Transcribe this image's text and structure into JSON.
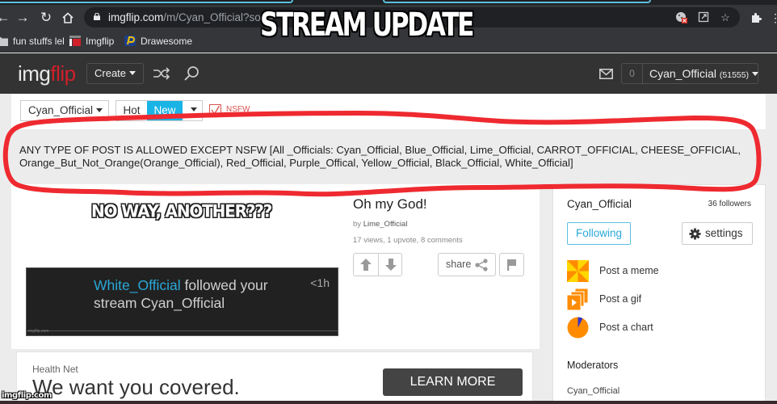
{
  "overlay": {
    "title": "STREAM UPDATE",
    "watermark": "imgflip.com"
  },
  "browser": {
    "url_host": "imgflip.com",
    "url_path": "/m/Cyan_Official?sort=",
    "nav": {
      "back": "back-icon",
      "forward": "forward-icon",
      "reload": "reload-icon",
      "home": "home-icon"
    },
    "omnibox_icons": [
      "cookie-blocked-icon",
      "open-external-icon",
      "star-icon"
    ],
    "extensions_icon": "puzzle-icon",
    "bookmarks": [
      {
        "label": "fun stuffs lel",
        "icon": "folder-icon"
      },
      {
        "label": "Imgflip",
        "icon": "imgflip-favicon"
      },
      {
        "label": "Drawesome",
        "icon": "drawesome-favicon"
      }
    ]
  },
  "header": {
    "logo_a": "img",
    "logo_b": "flip",
    "create_label": "Create",
    "notification_count": "0",
    "username": "Cyan_Official",
    "points": "(51555)",
    "colors": {
      "logo_red": "#d0202a",
      "bar": "#333333"
    }
  },
  "filters": {
    "stream": "Cyan_Official",
    "sort_hot": "Hot",
    "sort_new": "New",
    "nsfw_label": "NSFW",
    "nsfw_checked": true,
    "active_color": "#1ab3e6"
  },
  "stream_description": "ANY TYPE OF POST IS ALLOWED EXCEPT NSFW [All _Officials: Cyan_Official, Blue_Official, Lime_Official, CARROT_OFFICIAL, CHEESE_OFFICIAL, Orange_But_Not_Orange(Orange_Official), Red_Official, Purple_Offical, Yellow_Official, Black_Official, White_Official]",
  "post": {
    "meme_caption": "NO WAY, ANOTHER???",
    "notification": {
      "user": "White_Official",
      "text": " followed your stream Cyan_Official",
      "time": "<1h",
      "watermark": "imgflip.com"
    },
    "title": "Oh my God!",
    "by_prefix": "by ",
    "author": "Lime_Official",
    "stats": "17 views, 1 upvote, 8 comments",
    "share_label": "share"
  },
  "ad": {
    "brand": "Health Net",
    "headline": "We want you covered.",
    "cta": "LEARN MORE"
  },
  "sidebar": {
    "stream_name": "Cyan_Official",
    "followers": "36 followers",
    "following_label": "Following",
    "settings_label": "settings",
    "post_options": [
      {
        "label": "Post a meme",
        "icon": "pinwheel-icon"
      },
      {
        "label": "Post a gif",
        "icon": "gif-stack-icon"
      },
      {
        "label": "Post a chart",
        "icon": "pie-chart-icon"
      }
    ],
    "moderators_title": "Moderators",
    "moderators": [
      "Cyan_Official"
    ]
  }
}
